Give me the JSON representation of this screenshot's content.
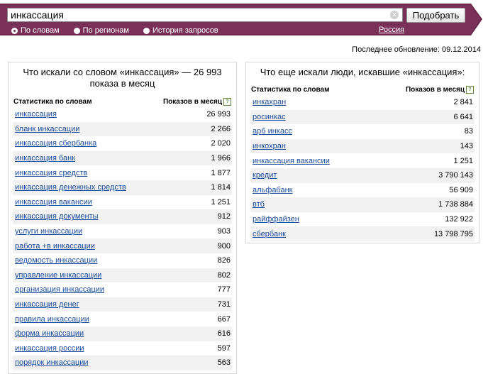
{
  "search": {
    "value": "инкассация",
    "button_label": "Подобрать"
  },
  "modes": [
    {
      "label": "По словам",
      "selected": true
    },
    {
      "label": "По регионам",
      "selected": false
    },
    {
      "label": "История запросов",
      "selected": false
    }
  ],
  "region": "Россия",
  "last_update": "Последнее обновление: 09.12.2014",
  "left_panel": {
    "title": "Что искали со словом «инкассация» — 26 993 показа в месяц",
    "col_phrase": "Статистика по словам",
    "col_count": "Показов в месяц",
    "rows": [
      {
        "phrase": "инкассация",
        "count": "26 993"
      },
      {
        "phrase": "бланк инкассации",
        "count": "2 266"
      },
      {
        "phrase": "инкассация сбербанка",
        "count": "2 020"
      },
      {
        "phrase": "инкассация банк",
        "count": "1 966"
      },
      {
        "phrase": "инкассация средств",
        "count": "1 877"
      },
      {
        "phrase": "инкассация денежных средств",
        "count": "1 814"
      },
      {
        "phrase": "инкассация вакансии",
        "count": "1 251"
      },
      {
        "phrase": "инкассация документы",
        "count": "912"
      },
      {
        "phrase": "услуги инкассации",
        "count": "903"
      },
      {
        "phrase": "работа +в инкассации",
        "count": "900"
      },
      {
        "phrase": "ведомость инкассации",
        "count": "826"
      },
      {
        "phrase": "управление инкассации",
        "count": "802"
      },
      {
        "phrase": "организация инкассации",
        "count": "777"
      },
      {
        "phrase": "инкассация денег",
        "count": "731"
      },
      {
        "phrase": "правила инкассации",
        "count": "667"
      },
      {
        "phrase": "форма инкассации",
        "count": "616"
      },
      {
        "phrase": "инкассация россии",
        "count": "597"
      },
      {
        "phrase": "порядок инкассации",
        "count": "563"
      }
    ]
  },
  "right_panel": {
    "title": "Что еще искали люди, искавшие «инкассация»:",
    "col_phrase": "Статистика по словам",
    "col_count": "Показов в месяц",
    "rows": [
      {
        "phrase": "инкахран",
        "count": "2 841"
      },
      {
        "phrase": "росинкас",
        "count": "6 641"
      },
      {
        "phrase": "арб инкасс",
        "count": "83"
      },
      {
        "phrase": "инкохран",
        "count": "143"
      },
      {
        "phrase": "инкассация вакансии",
        "count": "1 251"
      },
      {
        "phrase": "кредит",
        "count": "3 790 143"
      },
      {
        "phrase": "альфабанк",
        "count": "56 909"
      },
      {
        "phrase": "втб",
        "count": "1 738 884"
      },
      {
        "phrase": "райффайзен",
        "count": "132 922"
      },
      {
        "phrase": "сбербанк",
        "count": "13 798 795"
      }
    ]
  },
  "colors": {
    "bar": "#6b2a4c",
    "link": "#1a4b9a",
    "alt_row": "#f1f1f1"
  }
}
